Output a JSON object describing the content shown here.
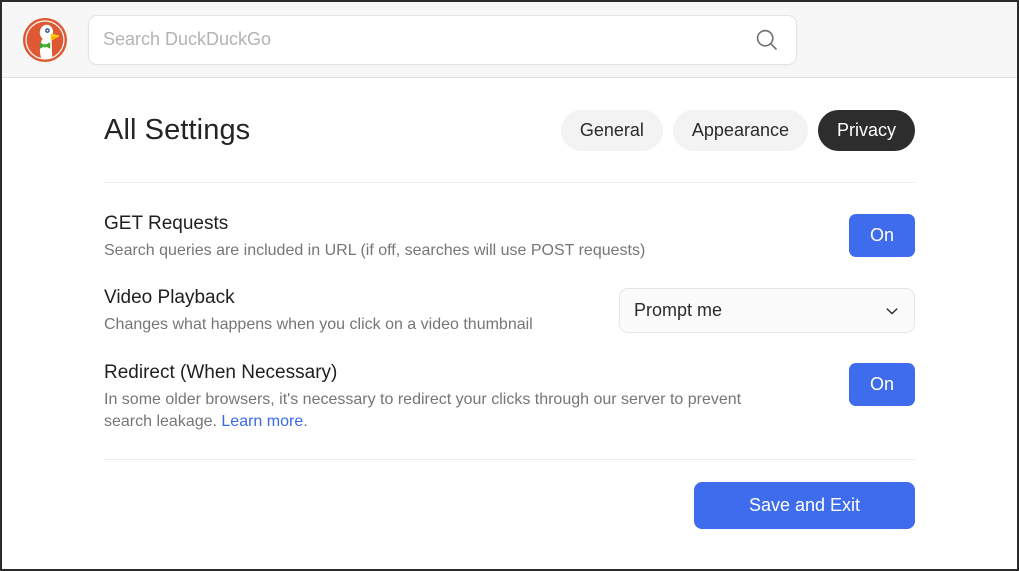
{
  "header": {
    "logo_name": "duckduckgo-duck-logo",
    "search": {
      "placeholder": "Search DuckDuckGo",
      "value": "",
      "icon": "search-icon"
    }
  },
  "main": {
    "title": "All Settings",
    "tabs": [
      {
        "label": "General",
        "active": false
      },
      {
        "label": "Appearance",
        "active": false
      },
      {
        "label": "Privacy",
        "active": true
      }
    ],
    "settings": [
      {
        "label": "GET Requests",
        "description": "Search queries are included in URL (if off, searches will use POST requests)",
        "control": "toggle",
        "value": "On"
      },
      {
        "label": "Video Playback",
        "description": "Changes what happens when you click on a video thumbnail",
        "control": "select",
        "value": "Prompt me",
        "chevron_icon": "chevron-down-icon"
      },
      {
        "label": "Redirect (When Necessary)",
        "description_part1": "In some older browsers, it's necessary to redirect your clicks through our server to prevent search leakage. ",
        "link_text": "Learn more",
        "description_part2": ".",
        "control": "toggle",
        "value": "On"
      }
    ],
    "save_button": "Save and Exit"
  },
  "colors": {
    "accent_blue": "#3f6ced",
    "link_blue": "#3969ef",
    "active_tab_bg": "#2d2d2d",
    "tab_bg": "#f3f3f3",
    "header_bg": "#f7f7f7",
    "logo_orange": "#de5833",
    "logo_bowtie_green": "#3ca82b",
    "logo_beak_yellow": "#fed30a"
  }
}
